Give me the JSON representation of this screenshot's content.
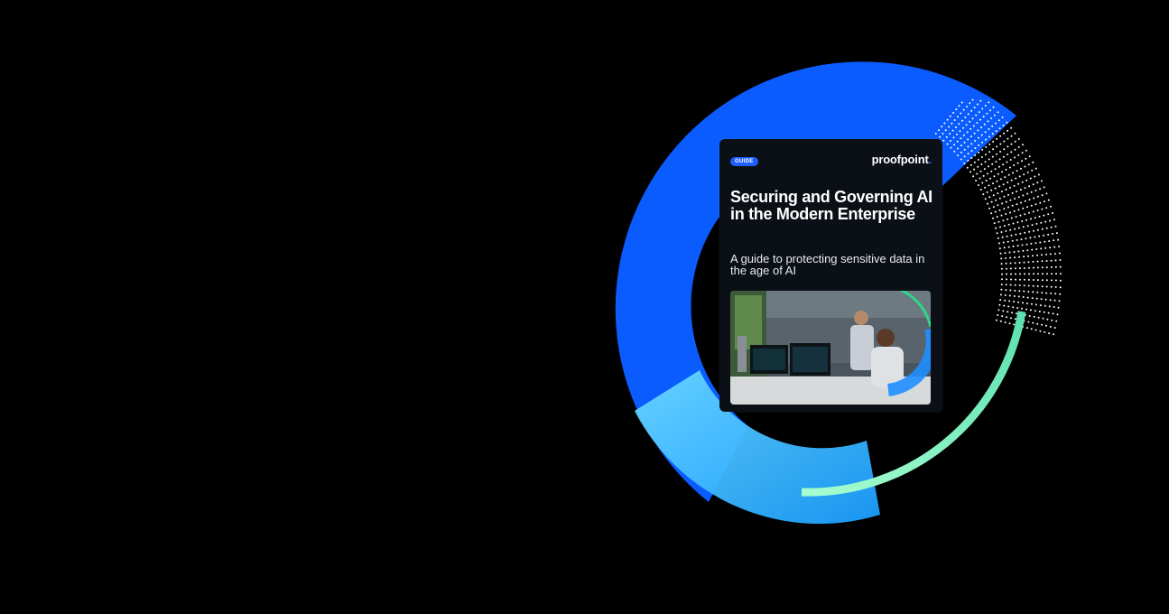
{
  "page": {
    "background": "#000000"
  },
  "colors": {
    "ring_blue": "#0a5cff",
    "ring_cyan": "#35b7ff",
    "ring_mint": "#7df0c2",
    "dots": "#ffffff"
  },
  "cover": {
    "badge": "GUIDE",
    "brand": "proofpoint",
    "title": "Securing and Governing AI in the Modern Enterprise",
    "subtitle": "A guide to protecting sensitive data in the age of AI",
    "image_icon": "office-photo"
  }
}
